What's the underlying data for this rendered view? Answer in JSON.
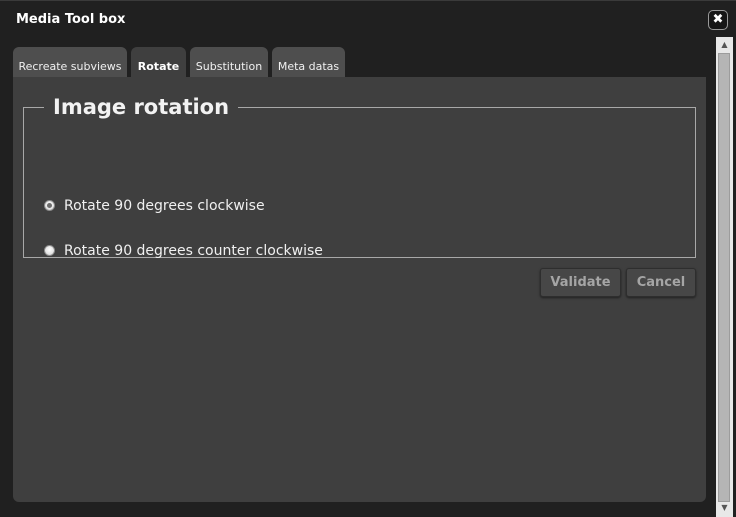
{
  "window": {
    "title": "Media Tool box",
    "close_icon_glyph": "✖"
  },
  "tabs": [
    {
      "label": "Recreate subviews",
      "active": false
    },
    {
      "label": "Rotate",
      "active": true
    },
    {
      "label": "Substitution",
      "active": false
    },
    {
      "label": "Meta datas",
      "active": false
    }
  ],
  "rotation": {
    "legend": "Image rotation",
    "options": [
      {
        "label": "Rotate 90 degrees clockwise",
        "checked": true
      },
      {
        "label": "Rotate 90 degrees counter clockwise",
        "checked": false
      }
    ]
  },
  "buttons": {
    "validate_label": "Validate",
    "cancel_label": "Cancel"
  },
  "scrollbar": {
    "up_arrow": "▲",
    "down_arrow": "▼"
  },
  "colors": {
    "background": "#202020",
    "panel": "#3f3f3f",
    "inactive_tab": "#4e4e4e",
    "button_text_disabled": "#a5a5a5"
  }
}
